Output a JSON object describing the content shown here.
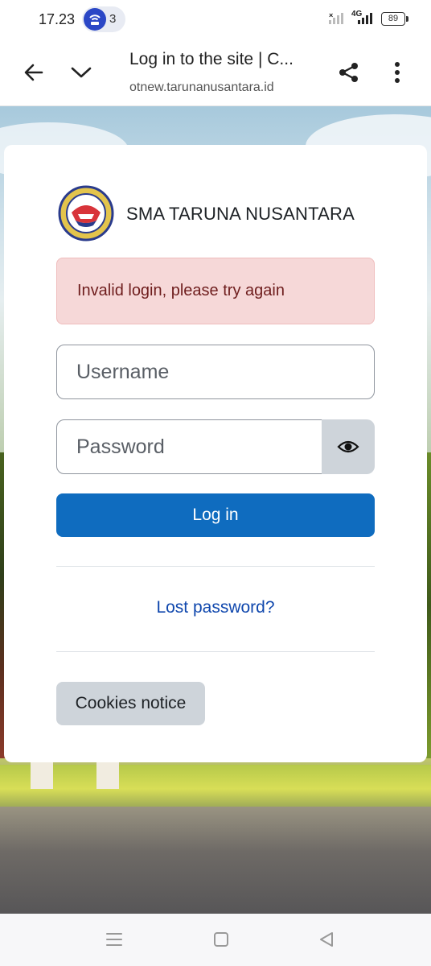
{
  "status_bar": {
    "time": "17.23",
    "notification_count": "3",
    "network": "4G",
    "battery": "89"
  },
  "browser": {
    "page_title": "Log in to the site | C...",
    "url": "otnew.tarunanusantara.id"
  },
  "site": {
    "name": "SMA TARUNA NUSANTARA"
  },
  "login": {
    "error_message": "Invalid login, please try again",
    "username_placeholder": "Username",
    "password_placeholder": "Password",
    "login_label": "Log in",
    "lost_password_label": "Lost password?",
    "cookies_label": "Cookies notice"
  },
  "colors": {
    "primary": "#0f6cbf",
    "alert_bg": "#f6d8d8",
    "alert_text": "#6e1d1d",
    "link": "#0f47ad"
  }
}
